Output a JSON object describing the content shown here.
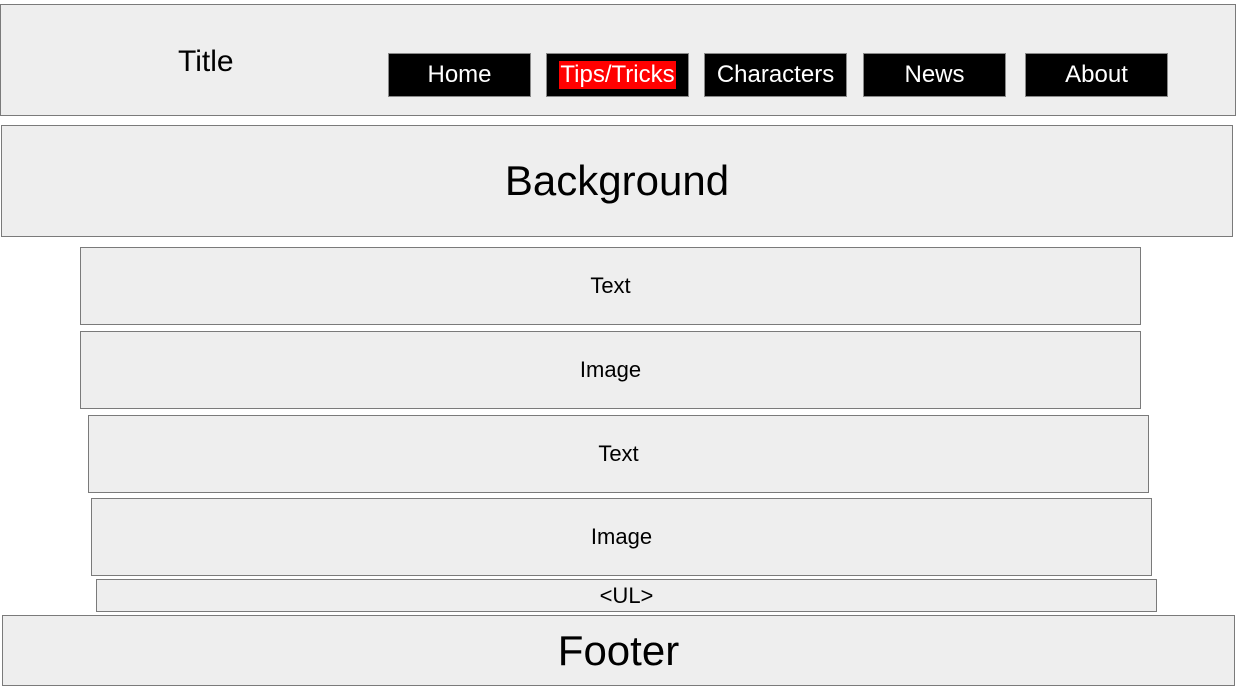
{
  "header": {
    "title": "Title",
    "nav": {
      "home": "Home",
      "tips": "Tips/Tricks",
      "characters": "Characters",
      "news": "News",
      "about": "About"
    },
    "active_color": "#ff0000",
    "nav_bg_color": "#000000"
  },
  "sections": {
    "background": "Background",
    "text_1": "Text",
    "image_1": "Image",
    "text_2": "Text",
    "image_2": "Image",
    "list": "<UL>"
  },
  "footer": {
    "label": "Footer"
  },
  "colors": {
    "box_fill": "#eeeeee",
    "box_border": "#7a7a7a"
  }
}
